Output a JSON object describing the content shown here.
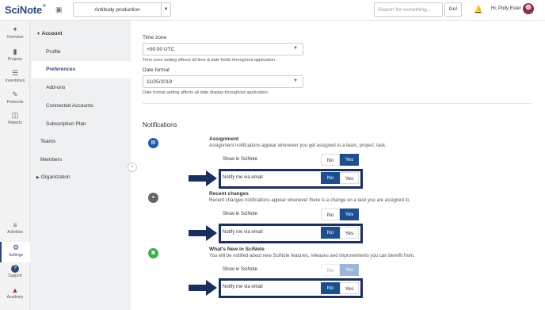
{
  "topbar": {
    "logo": "SciNote",
    "logo_sup": "®",
    "project": "Antibody production",
    "search_placeholder": "Search for something...",
    "go_label": "Go!",
    "greeting": "Hi, Polly Ester",
    "icons": [
      "archive-icon",
      "bell-icon"
    ]
  },
  "leftnav": [
    {
      "label": "Overview",
      "icon": "pin-icon"
    },
    {
      "label": "Projects",
      "icon": "folder-icon"
    },
    {
      "label": "Inventories",
      "icon": "list-icon"
    },
    {
      "label": "Protocols",
      "icon": "edit-icon"
    },
    {
      "label": "Reports",
      "icon": "clipboard-icon"
    },
    {
      "label": "Activities",
      "icon": "activities-icon"
    },
    {
      "label": "Settings",
      "icon": "gear-icon"
    },
    {
      "label": "Support",
      "icon": "question-icon"
    },
    {
      "label": "Academy",
      "icon": "graduation-icon"
    }
  ],
  "settings_nav": {
    "account": "Account",
    "items": [
      "Profile",
      "Preferences",
      "Add-ons",
      "Connected Accounts",
      "Subscription Plan"
    ],
    "teams": "Teams",
    "members": "Members",
    "organization": "Organization"
  },
  "preferences": {
    "timezone_label": "Time zone",
    "timezone_value": "+00:00 UTC",
    "timezone_hint": "Time zone setting affects all time & date fields throughout application.",
    "date_label": "Date format",
    "date_value": "11/25/2019",
    "date_hint": "Date format setting affects all date display throughout application."
  },
  "notifications": {
    "title": "Notifications",
    "sections": [
      {
        "title": "Assignment",
        "desc": "Assignment notifications appear whenever you get assigned to a team, project, task.",
        "show_label": "Show in SciNote",
        "email_label": "Notify me via email"
      },
      {
        "title": "Recent changes",
        "desc": "Recent changes notifications appear whenever there is a change on a task you are assigned to.",
        "show_label": "Show in SciNote",
        "email_label": "Notify me via email"
      },
      {
        "title": "What's New in SciNote",
        "desc": "You will be notified about new SciNote features, releases and improvements you can benefit from.",
        "show_label": "Show in SciNote",
        "email_label": "Notify me via email"
      }
    ],
    "no_label": "No",
    "yes_label": "Yes"
  },
  "colors": {
    "brand": "#2b4a7a",
    "toggle_on": "#1d4f8f",
    "highlight_box": "#1b2f5c",
    "assignment_icon": "#1d5fa8",
    "recent_icon": "#666666",
    "whatsnew_icon": "#3cb34a"
  }
}
